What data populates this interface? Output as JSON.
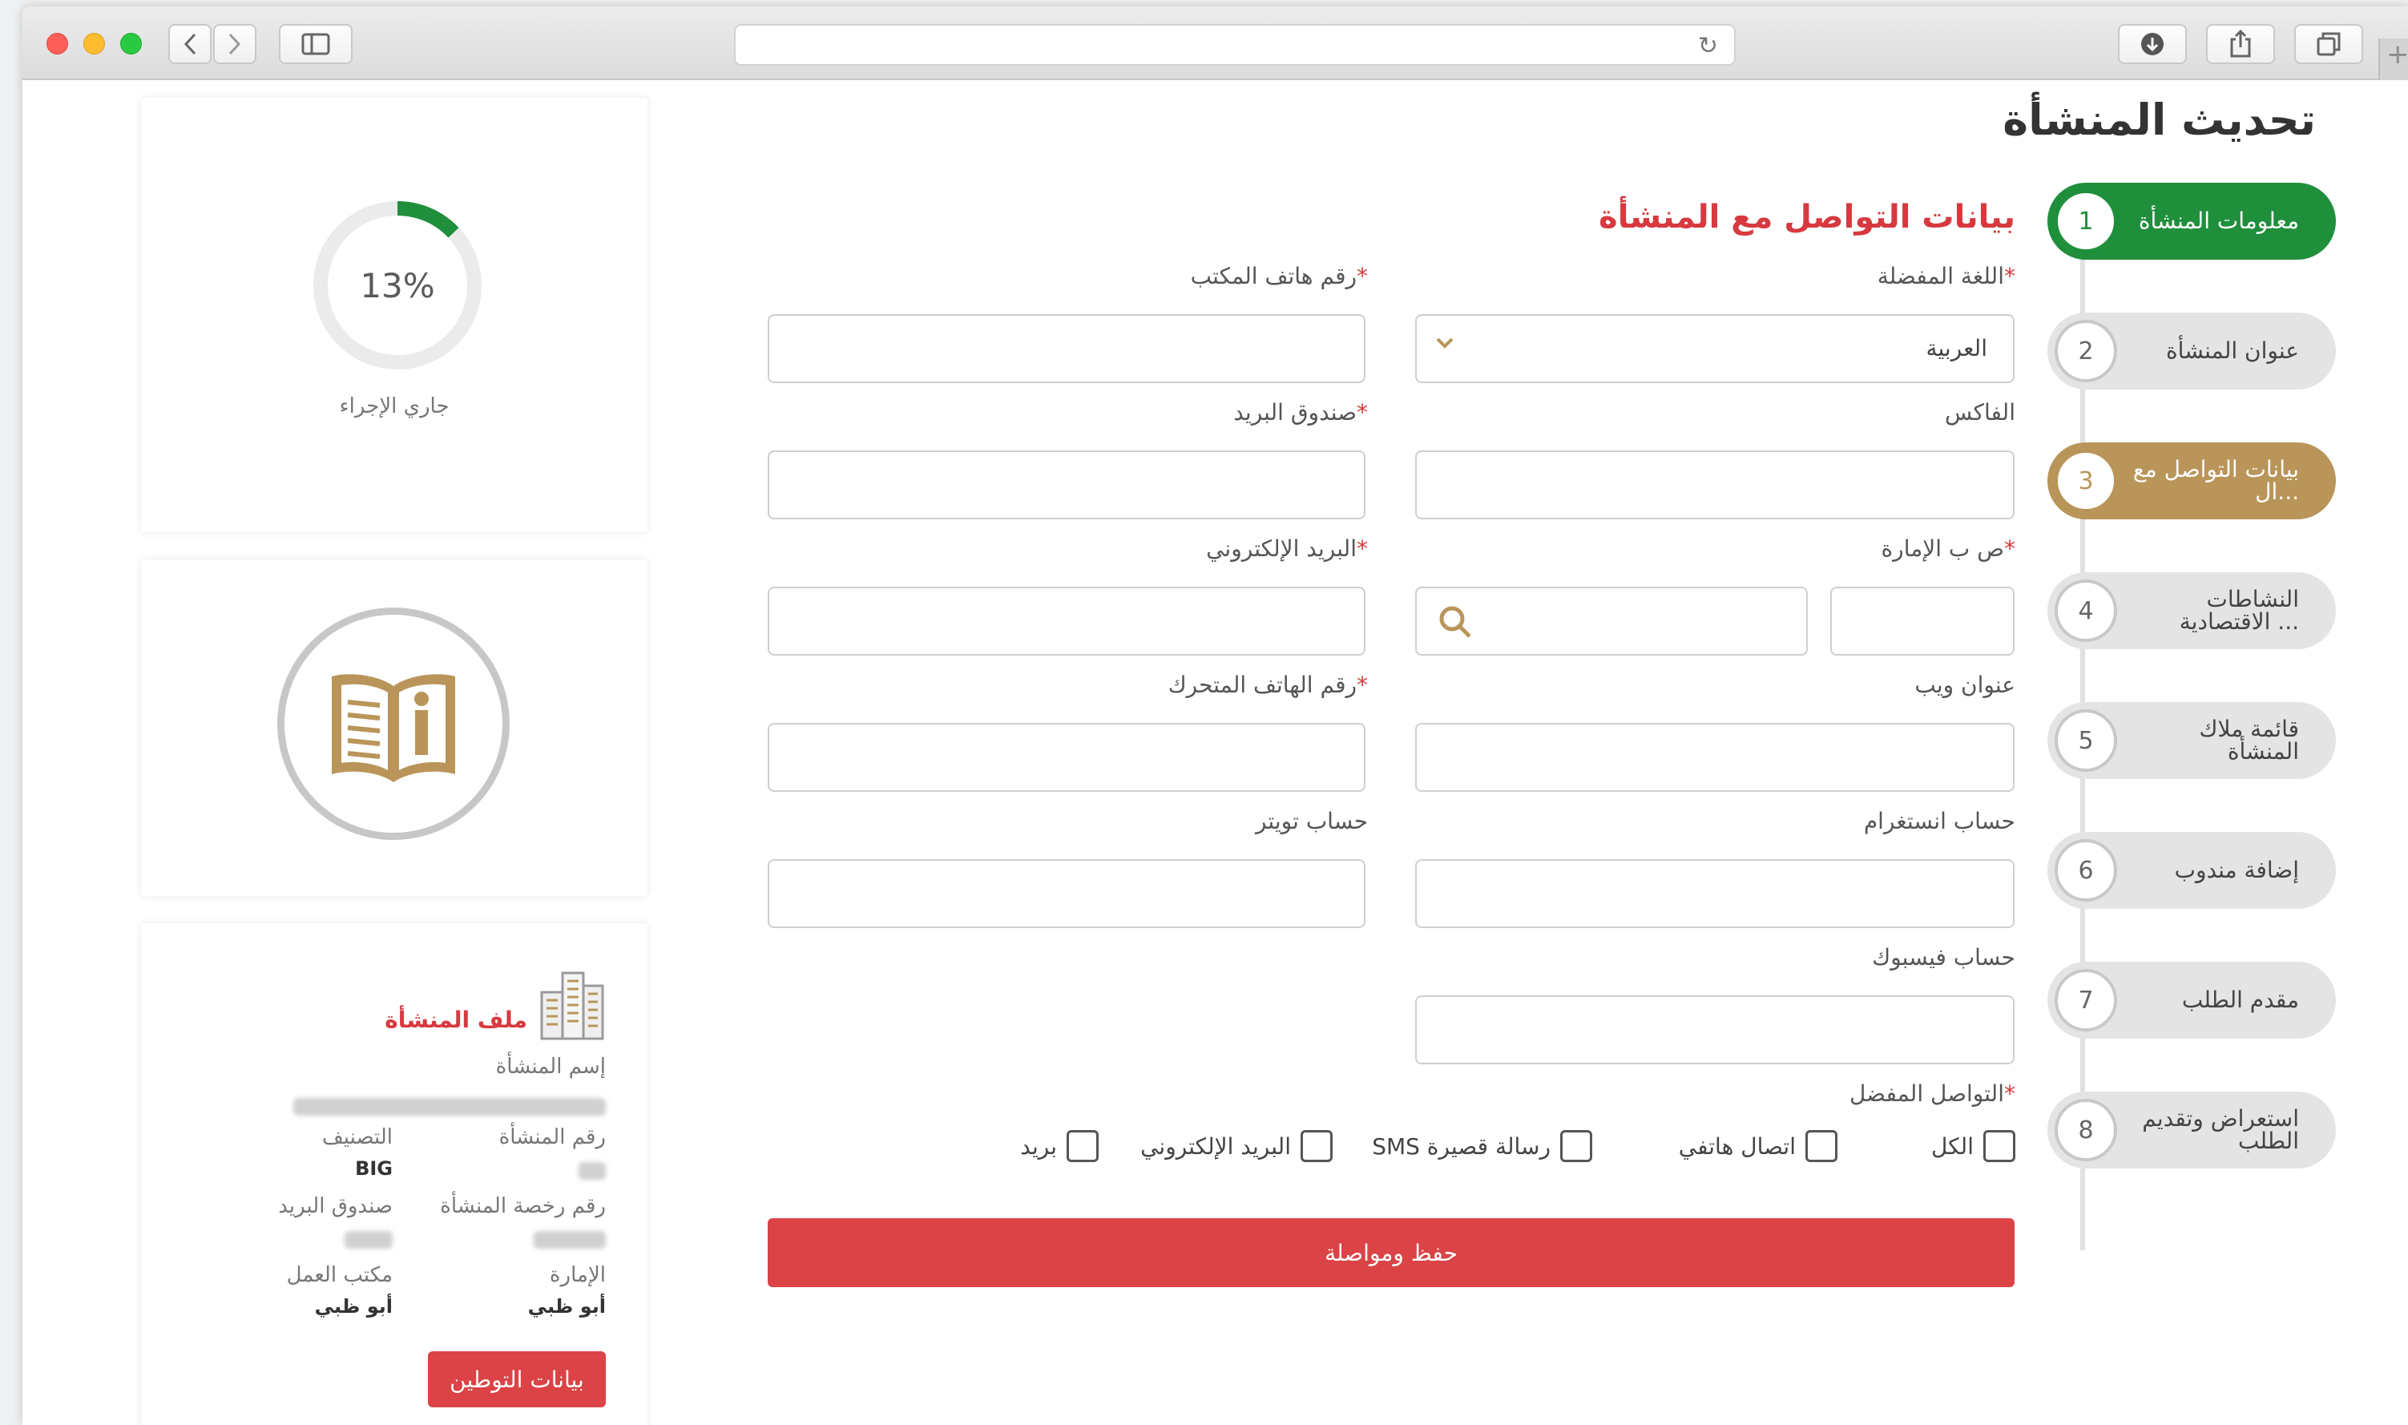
{
  "header": {
    "page_title": "تحديث المنشأة",
    "section_title": "بيانات التواصل مع المنشأة"
  },
  "progress": {
    "value": 0.13,
    "label": "13%",
    "status": "جاري الإجراء",
    "color": "#1f8f3c"
  },
  "steps": [
    {
      "num": "1",
      "label": "معلومات المنشأة",
      "state": "done"
    },
    {
      "num": "2",
      "label": "عنوان المنشأة",
      "state": "pending"
    },
    {
      "num": "3",
      "label": "بيانات التواصل مع ال...",
      "state": "active"
    },
    {
      "num": "4",
      "label": "النشاطات الاقتصادية ...",
      "state": "pending"
    },
    {
      "num": "5",
      "label": "قائمة ملاك المنشأة",
      "state": "pending"
    },
    {
      "num": "6",
      "label": "إضافة مندوب",
      "state": "pending"
    },
    {
      "num": "7",
      "label": "مقدم الطلب",
      "state": "pending"
    },
    {
      "num": "8",
      "label": "استعراض وتقديم الطلب",
      "state": "pending"
    }
  ],
  "form": {
    "preferred_language": {
      "label": "اللغة المفضلة",
      "value": "العربية"
    },
    "office_phone": {
      "label": "رقم هاتف المكتب"
    },
    "fax": {
      "label": "الفاكس"
    },
    "po_box": {
      "label": "صندوق البريد"
    },
    "emirate_po": {
      "label": "ص ب الإمارة"
    },
    "email": {
      "label": "البريد الإلكتروني"
    },
    "website": {
      "label": "عنوان ويب"
    },
    "mobile": {
      "label": "رقم الهاتف المتحرك"
    },
    "instagram": {
      "label": "حساب انستغرام"
    },
    "twitter": {
      "label": "حساب تويتر"
    },
    "facebook": {
      "label": "حساب فيسبوك"
    },
    "preferred_contact": {
      "label": "التواصل المفضل",
      "options": [
        "الكل",
        "اتصال هاتفي",
        "رسالة قصيرة SMS",
        "البريد الإلكتروني",
        "بريد"
      ]
    },
    "required_mark": "*",
    "save_label": "حفظ ومواصلة"
  },
  "profile": {
    "title": "ملف المنشأة",
    "name_label": "إسم المنشأة",
    "number_label": "رقم المنشأة",
    "classification_label": "التصنيف",
    "classification_value": "BIG",
    "license_label": "رقم رخصة المنشأة",
    "po_box_label": "صندوق البريد",
    "emirate_label": "الإمارة",
    "emirate_value": "أبو ظبي",
    "work_office_label": "مكتب العمل",
    "work_office_value": "أبو ظبي",
    "localization_button": "بيانات التوطين"
  },
  "colors": {
    "accent_red": "#db4346",
    "gold": "#b9955a",
    "green": "#1f8f3c"
  },
  "browser": {
    "icons": [
      "back-icon",
      "forward-icon",
      "sidebar-icon",
      "reload-icon",
      "download-icon",
      "share-icon",
      "tabs-icon"
    ]
  }
}
